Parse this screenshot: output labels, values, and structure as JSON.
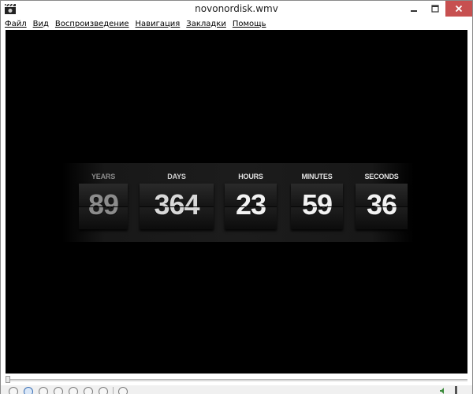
{
  "window": {
    "title": "novonordisk.wmv"
  },
  "menu": {
    "items": [
      "Файл",
      "Вид",
      "Воспроизведение",
      "Навигация",
      "Закладки",
      "Помощь"
    ]
  },
  "countdown": {
    "units": [
      {
        "label": "YEARS",
        "value": "89"
      },
      {
        "label": "DAYS",
        "value": "364"
      },
      {
        "label": "HOURS",
        "value": "23"
      },
      {
        "label": "MINUTES",
        "value": "59"
      },
      {
        "label": "SECONDS",
        "value": "36"
      }
    ]
  },
  "player": {
    "position": 0,
    "colors": {
      "video_background": "#000000",
      "close_button": "#c75050",
      "active_control": "#3a6fb5"
    },
    "controls": [
      "play-icon",
      "pause-icon",
      "stop-icon",
      "previous-icon",
      "rewind-icon",
      "forward-icon",
      "next-icon",
      "fullscreen-icon"
    ]
  }
}
